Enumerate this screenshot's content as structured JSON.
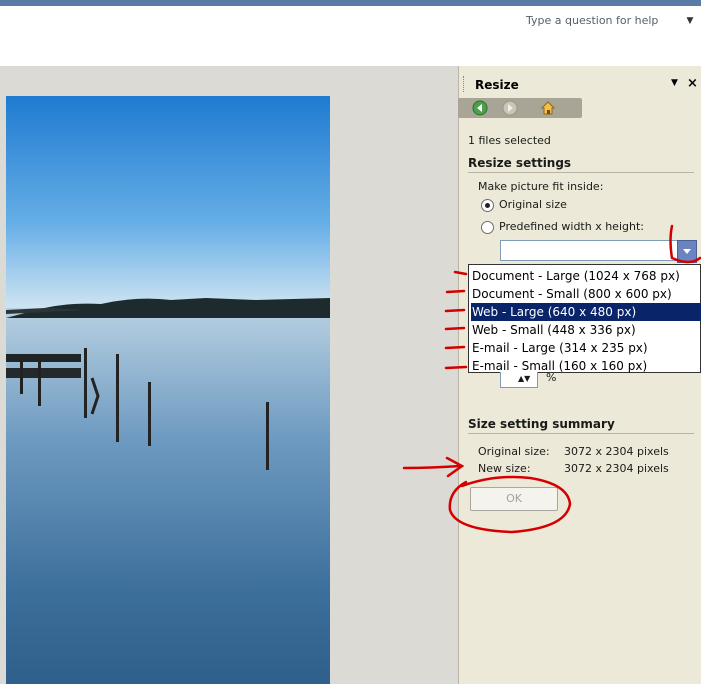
{
  "help": {
    "placeholder": "Type a question for help"
  },
  "pane": {
    "title": "Resize",
    "menu_glyph": "▼",
    "close_glyph": "×",
    "files_selected": "1 files selected",
    "settings_header": "Resize settings",
    "fit_label": "Make picture fit inside:",
    "radio_original": "Original size",
    "radio_predefined": "Predefined width x height:",
    "percent_sign": "%",
    "summary_header": "Size setting summary",
    "original_label": "Original size:",
    "original_value": "3072 x 2304 pixels",
    "new_label": "New size:",
    "new_value": "3072 x 2304 pixels",
    "ok_label": "OK"
  },
  "dropdown": {
    "selected_index": 2,
    "options": [
      "Document - Large (1024 x 768 px)",
      "Document - Small (800 x 600 px)",
      "Web - Large (640 x 480 px)",
      "Web - Small (448 x 336 px)",
      "E-mail - Large (314 x 235 px)",
      "E-mail - Small (160 x 160 px)"
    ]
  },
  "icons": {
    "back": "back-icon",
    "forward": "forward-icon",
    "home": "home-icon"
  },
  "colors": {
    "accent": "#0a246a",
    "annotation": "#d40000",
    "pane_bg": "#ece9d8"
  }
}
